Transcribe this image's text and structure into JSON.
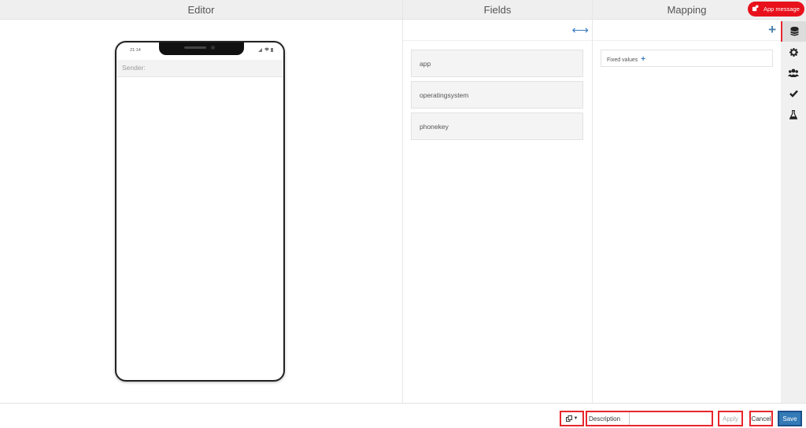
{
  "headers": {
    "editor": "Editor",
    "fields": "Fields",
    "mapping": "Mapping"
  },
  "badge": {
    "label": "App message"
  },
  "phone": {
    "time": "21:14",
    "sender_label": "Sender:"
  },
  "fields": {
    "items": [
      "app",
      "operatingsystem",
      "phonekey"
    ]
  },
  "mapping": {
    "fixed_values_label": "Fixed values"
  },
  "footer": {
    "description_placeholder": "Description",
    "apply_label": "Apply",
    "cancel_label": "Cancel",
    "save_label": "Save"
  },
  "rail": {
    "icons": [
      "database-icon",
      "gear-icon",
      "users-icon",
      "check-icon",
      "flask-icon"
    ]
  },
  "colors": {
    "accent_red": "#e8111b",
    "primary_blue": "#337ab7"
  }
}
